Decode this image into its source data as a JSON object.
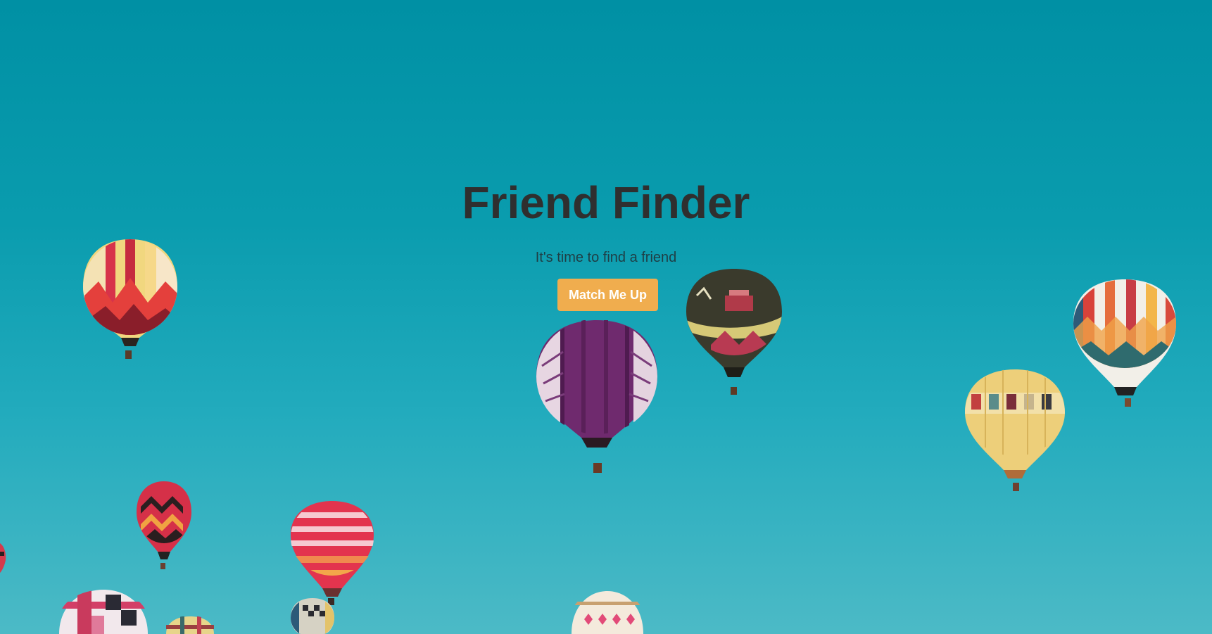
{
  "hero": {
    "title": "Friend Finder",
    "subtitle": "It's time to find a friend",
    "button_label": "Match Me Up"
  },
  "colors": {
    "sky_top": "#0090a4",
    "sky_bottom": "#4cbac6",
    "title_text": "#2f2f2f",
    "button_background": "#f0ad4e",
    "button_text": "#ffffff"
  },
  "background": {
    "description_icon": "hot-air-balloons-image"
  }
}
